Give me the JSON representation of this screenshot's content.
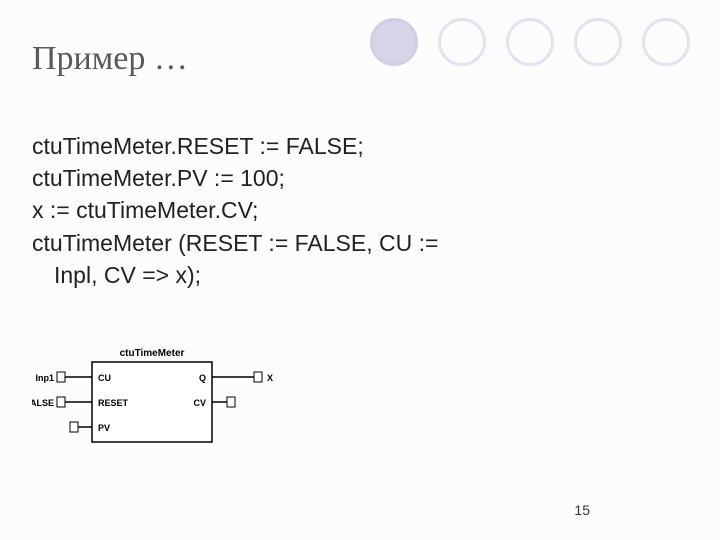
{
  "title": "Пример …",
  "code": {
    "l1": "ctuTimeMeter.RESET := FALSE;",
    "l2": "ctuTimeMeter.PV := 100;",
    "l3": "x := ctuTimeMeter.CV;",
    "l4": "ctuTimeMeter (RESET := FALSE, CU :=",
    "l5": "Inpl, CV => x);"
  },
  "diagram": {
    "block_name": "ctuTimeMeter",
    "in1_signal": "Inp1",
    "in1_port": "CU",
    "in2_signal": "FALSE",
    "in2_port": "RESET",
    "in3_port": "PV",
    "out1_port": "Q",
    "out1_signal": "X",
    "out2_port": "CV"
  },
  "page": "15"
}
